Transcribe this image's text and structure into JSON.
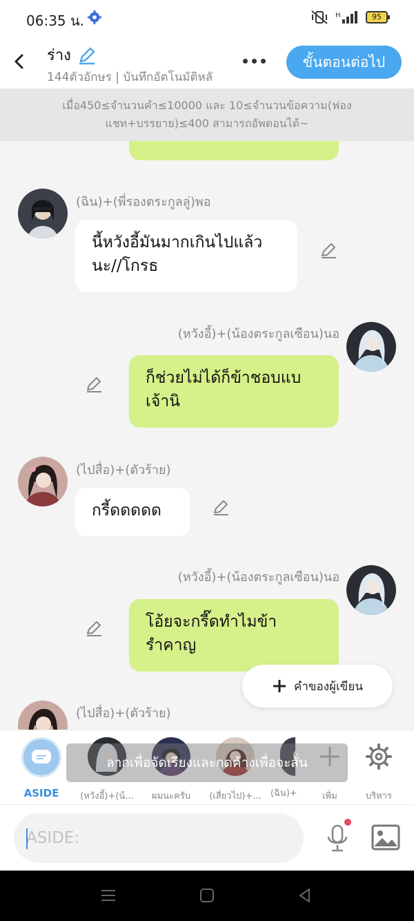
{
  "status_bar": {
    "time": "06:35 น.",
    "battery": "95"
  },
  "header": {
    "title": "ร่าง",
    "subtitle": "144ตัวอักษร | บันทึกอัตโนมัติหลั",
    "next_button": "ขั้นตอนต่อไป"
  },
  "notice": {
    "line1": "เมื่อ450≤จำนวนคำ≤10000 และ 10≤จำนวนข้อความ(ฟอง",
    "line2": "แชท+บรรยาย)≤400 สามารถอัพตอนได้~"
  },
  "messages": [
    {
      "speaker": "(ฉิน)+(พี่รองตระกูลลู่)พอ",
      "line1": "นี้หวังอี้มันมากเกินไปแล้ว",
      "line2": "นะ//โกรธ"
    },
    {
      "speaker": "(หวังอี้)+(น้องตระกูลเซือน)นอ",
      "line1": "ก็ช่วยไม่ได้ก็ข้าชอบแบ",
      "line2": "เจ้านิ"
    },
    {
      "speaker": "(ไปสื่อ)+(ตัวร้าย)",
      "line1": "กรี้ดดดดด",
      "line2": ""
    },
    {
      "speaker": "(หวังอี้)+(น้องตระกูลเซือน)นอ",
      "line1": "โอ้ยจะกรี๊ดทำไมข้า",
      "line2": "รำคาญ"
    },
    {
      "speaker": "(ไปสื่อ)+(ตัวร้าย)"
    }
  ],
  "author_note_button": "คำของผู้เขียน",
  "characters": {
    "aside": "ASIDE",
    "items": [
      "(หวังอี้)+(น้...",
      "ผมนะครับ",
      "(เสี่ยวไป)+...",
      "(ฉิน)+"
    ],
    "add": "เพิ่ม",
    "manage": "บริหาร"
  },
  "toast": "ลากเพื่อจัดเรียงและกดค้างเพื่อจะสั่น",
  "input": {
    "placeholder": "ASIDE:"
  },
  "colors": {
    "accent": "#4aa8f0",
    "bubble_green": "#d6f08a",
    "aside_blue": "#3b8fe0"
  }
}
